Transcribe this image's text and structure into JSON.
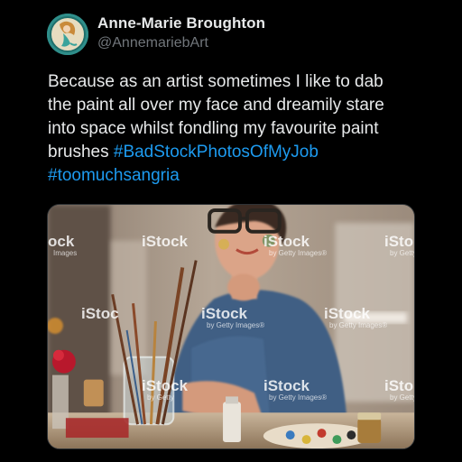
{
  "author": {
    "display_name": "Anne-Marie Broughton",
    "handle": "@AnnemariebArt",
    "avatar_icon": "mermaid-avatar-icon"
  },
  "tweet": {
    "lines": [
      "Because as an artist sometimes I like to dab",
      "the paint all over my face and dreamily stare",
      "into space whilst fondling my favourite paint",
      "brushes "
    ],
    "hashtag_1": "#BadStockPhotosOfMyJob",
    "hashtag_2": "#toomuchsangria"
  },
  "media": {
    "description_icon": "stock-photo-painter-image",
    "watermark_brand": "iStock",
    "watermark_sub": "by Getty Images®",
    "watermark_partial_left": "ock",
    "watermark_partial_left_sub": "Images",
    "watermark_partial_right": "iSto",
    "watermark_partial_right_sub": "by Getty",
    "watermark_partial_mid_left": "iStoc",
    "watermark_partial_mid_left_sub": "by Getty",
    "colors": {
      "hashtag": "#1d9bf0",
      "background": "#000000",
      "handle": "#71767b"
    }
  }
}
